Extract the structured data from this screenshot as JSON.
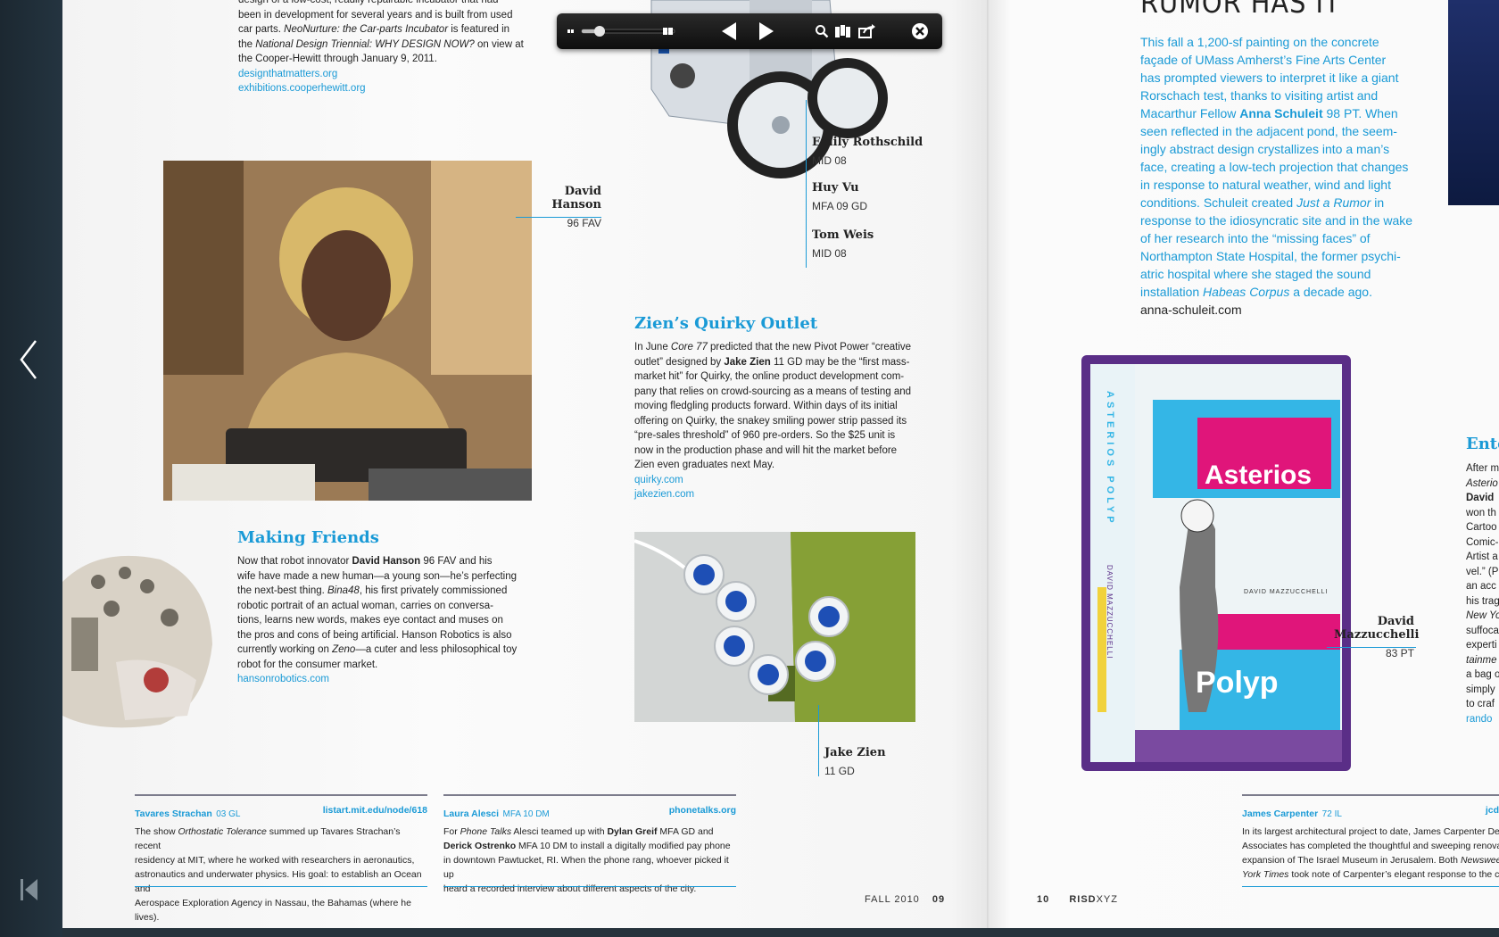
{
  "viewer": {
    "prev_page_label": "Previous page",
    "first_page_label": "First page",
    "toolbar": {
      "icons": [
        "zoom-out-icon",
        "zoom-slider",
        "zoom-in-icon",
        "previous-icon",
        "play-icon",
        "search-icon",
        "thumbnails-icon",
        "share-icon",
        "close-icon"
      ]
    }
  },
  "left_page": {
    "intro": {
      "line1": "design of a low-cost, readily repairable incubator that had",
      "line2": "been in development for several years and is built from used",
      "line3_a": "car parts. ",
      "line3_em": "NeoNurture: the Car-parts Incubator",
      "line3_b": " is featured in",
      "line4_a": "the ",
      "line4_em": "National Design Triennial: WHY DESIGN NOW?",
      "line4_b": " on view at",
      "line5": "the Cooper-Hewitt through January 9, 2011.",
      "link1": "designthatmatters.org",
      "link2": "exhibitions.cooperhewitt.org"
    },
    "credits_top": [
      {
        "name": "Emily Rothschild",
        "degree": "MID 08"
      },
      {
        "name": "Huy Vu",
        "degree": "MFA 09 GD"
      },
      {
        "name": "Tom Weis",
        "degree": "MID 08"
      }
    ],
    "hanson_credit": {
      "name_line1": "David",
      "name_line2": "Hanson",
      "degree": "96 FAV"
    },
    "zien": {
      "title": "Zien’s Quirky Outlet",
      "l1_a": "In June ",
      "l1_em": "Core 77",
      "l1_b": " predicted that the new Pivot Power “creative",
      "l2_a": "outlet” designed by ",
      "l2_b": "Jake Zien",
      "l2_c": " 11 GD may be the “first mass-",
      "l3": "market hit” for Quirky, the online product development com-",
      "l4": "pany that relies on crowd-sourcing as a means of testing and",
      "l5": "moving fledgling products forward. Within days of its initial",
      "l6": "offering on Quirky, the snakey smiling power strip passed its",
      "l7": "“pre-sales threshold” of 960 pre-orders. So the $25 unit is",
      "l8": "now in the production phase and will hit the market before",
      "l9": "Zien even graduates next May.",
      "link1": "quirky.com",
      "link2": "jakezien.com",
      "credit_name": "Jake Zien",
      "credit_degree": "11 GD"
    },
    "making_friends": {
      "title": "Making Friends",
      "l1_a": "Now that robot innovator ",
      "l1_b": "David Hanson",
      "l1_c": " 96 FAV and his",
      "l2": "wife have made a new human—a young son—he’s perfecting",
      "l3_a": "the next-best thing. ",
      "l3_em": "Bina48",
      "l3_b": ", his first privately commissioned",
      "l4": "robotic portrait of an actual woman, carries on conversa-",
      "l5": "tions, learns new words, makes eye contact and muses on",
      "l6": "the pros and cons of being artificial. Hanson Robotics is also",
      "l7_a": "currently working on ",
      "l7_em": "Zeno",
      "l7_b": "—a cuter and less philosophical toy",
      "l8": "robot for the consumer market.",
      "link": "hansonrobotics.com"
    },
    "footer_boxes": [
      {
        "name": "Tavares Strachan",
        "degree": "03 GL",
        "link": "listart.mit.edu/node/618",
        "l1_a": "The show ",
        "l1_em": "Orthostatic Tolerance",
        "l1_b": " summed up Tavares Strachan’s recent",
        "l2": "residency at MIT, where he worked with researchers in aeronautics,",
        "l3": "astronautics and underwater physics. His goal: to establish an Ocean and",
        "l4": "Aerospace Exploration Agency in Nassau, the Bahamas (where he lives)."
      },
      {
        "name": "Laura Alesci",
        "degree": "MFA 10 DM",
        "link": "phonetalks.org",
        "l1_a": "For ",
        "l1_em": "Phone Talks",
        "l1_b": " Alesci teamed up with ",
        "l1_c": "Dylan Greif",
        "l1_d": " MFA GD and",
        "l2_a": "Derick Ostrenko",
        "l2_b": " MFA 10 DM to install a digitally modified pay phone",
        "l3": "in downtown Pawtucket, RI. When the phone rang, whoever picked it up",
        "l4": "heard a recorded interview about different aspects of the city."
      }
    ],
    "folio": {
      "season": "FALL 2010",
      "page": "09"
    }
  },
  "right_page": {
    "headline": "RUMOR HAS IT",
    "rumor": {
      "l1": "This fall a 1,200-sf painting on the concrete",
      "l2": "façade of UMass Amherst’s Fine Arts Center",
      "l3": "has prompted viewers to interpret it like a giant",
      "l4": "Rorschach test, thanks to visiting artist and",
      "l5_a": "Macarthur Fellow ",
      "l5_b": "Anna Schuleit",
      "l5_c": " 98 PT. When",
      "l6": "seen reflected in the adjacent pond, the seem-",
      "l7": "ingly abstract design crystallizes into a man’s",
      "l8": "face, creating a low-tech projection that changes",
      "l9": "in response to natural weather, wind and light",
      "l10_a": "conditions. Schuleit created ",
      "l10_em": "Just a Rumor",
      "l10_b": " in",
      "l11": "response to the idiosyncratic site and in the wake",
      "l12": "of her research into the “missing faces” of",
      "l13": "Northampton State Hospital, the former psychi-",
      "l14": "atric hospital where she staged the sound",
      "l15_a": "installation ",
      "l15_em": "Habeas Corpus",
      "l15_b": " a decade ago.",
      "link": "anna-schuleit.com"
    },
    "book": {
      "title_spine": "ASTERIOS POLYP",
      "author_spine": "DAVID MAZZUCCHELLI",
      "cover_word1": "Asterios",
      "cover_author": "DAVID MAZZUCCHELLI",
      "cover_word2": "Polyp"
    },
    "mazzucchelli_credit": {
      "name_line1": "David",
      "name_line2": "Mazzucchelli",
      "degree": "83 PT"
    },
    "side_column": {
      "title": "Ente",
      "lines": [
        "After m",
        "Asterio",
        "David",
        "won th",
        "Cartoo",
        "Comic-",
        "Artist a",
        "vel.” (P",
        "an acc",
        "his trag",
        "New Yo",
        "suffoca",
        "experti",
        "tainme",
        "a bag o",
        "simply",
        "to craf",
        "rando"
      ]
    },
    "footer_box": {
      "name": "James Carpenter",
      "degree": "72 IL",
      "link": "jcd",
      "l1": "In its largest architectural project to date, James Carpenter Design",
      "l2": "Associates has completed the thoughtful and sweeping renovatio",
      "l3_a": "expansion of The Israel Museum in Jerusalem. Both ",
      "l3_em": "Newsweek",
      "l3_b": " and",
      "l4_em": "York Times",
      "l4_b": " took note of Carpenter’s elegant response to the challe"
    },
    "folio": {
      "page": "10",
      "brand_a": "RISD",
      "brand_b": "XYZ"
    }
  },
  "colors": {
    "accent": "#1a9ad6",
    "sidebar": "#1d2a33",
    "paper": "#fafafa"
  }
}
